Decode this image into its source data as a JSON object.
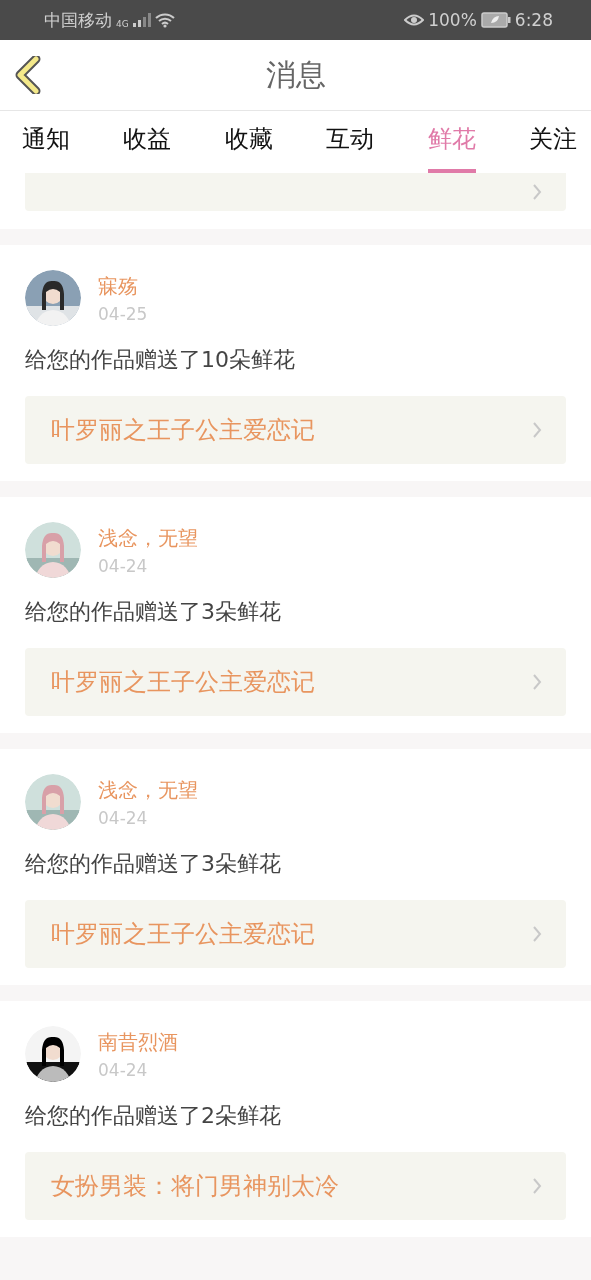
{
  "status_bar": {
    "carrier": "中国移动",
    "network": "4G",
    "battery": "100%",
    "time": "6:28"
  },
  "header": {
    "title": "消息"
  },
  "tabs": [
    {
      "label": "通知",
      "selected": false
    },
    {
      "label": "收益",
      "selected": false
    },
    {
      "label": "收藏",
      "selected": false
    },
    {
      "label": "互动",
      "selected": false
    },
    {
      "label": "鲜花",
      "selected": true
    },
    {
      "label": "关注",
      "selected": false
    }
  ],
  "messages": [
    {
      "user": "寐殇",
      "date": "04-25",
      "text": "给您的作品赠送了10朵鲜花",
      "book": "叶罗丽之王子公主爱恋记"
    },
    {
      "user": "浅念，无望",
      "date": "04-24",
      "text": "给您的作品赠送了3朵鲜花",
      "book": "叶罗丽之王子公主爱恋记"
    },
    {
      "user": "浅念，无望",
      "date": "04-24",
      "text": "给您的作品赠送了3朵鲜花",
      "book": "叶罗丽之王子公主爱恋记"
    },
    {
      "user": "南昔烈酒",
      "date": "04-24",
      "text": "给您的作品赠送了2朵鲜花",
      "book": "女扮男装：将门男神别太冷"
    }
  ]
}
